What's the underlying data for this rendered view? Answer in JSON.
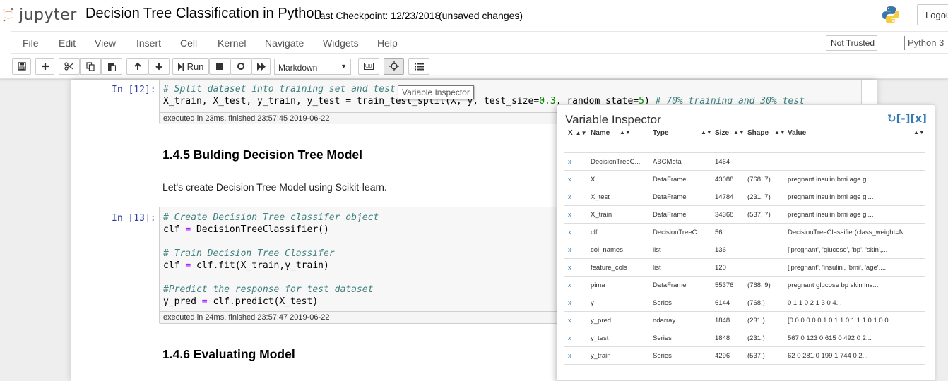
{
  "app": {
    "logo_text": "jupyter",
    "notebook_title": "Decision Tree Classification in Python",
    "checkpoint": "Last Checkpoint: 12/23/2018",
    "unsaved": "(unsaved changes)",
    "logout": "Logout"
  },
  "menu": {
    "items": [
      "File",
      "Edit",
      "View",
      "Insert",
      "Cell",
      "Kernel",
      "Navigate",
      "Widgets",
      "Help"
    ],
    "not_trusted": "Not Trusted",
    "kernel": "Python 3"
  },
  "toolbar": {
    "run_label": "Run",
    "cell_type": "Markdown",
    "tooltip": "Variable Inspector"
  },
  "cells": {
    "c12": {
      "prompt": "In [12]:",
      "line1": "# Split dataset into training set and test set",
      "line2_a": "X_train, X_test, y_train, y_test = train_test_split(X, y, test_size=",
      "line2_num1": "0.3",
      "line2_b": ", random_state=",
      "line2_num2": "5",
      "line2_c": ") ",
      "line2_comment": "# 70% training and 30% test",
      "exec": "executed in 23ms, finished 23:57:45 2019-06-22"
    },
    "h145": "1.4.5  Bulding Decision Tree Model",
    "md_text": "Let's create Decision Tree Model using Scikit-learn.",
    "c13": {
      "prompt": "In [13]:",
      "l1": "# Create Decision Tree classifer object",
      "l2a": "clf ",
      "l2op": "=",
      "l2b": " DecisionTreeClassifier()",
      "l4": "# Train Decision Tree Classifer",
      "l5a": "clf ",
      "l5op": "=",
      "l5b": " clf.fit(X_train,y_train)",
      "l7": "#Predict the response for test dataset",
      "l8a": "y_pred ",
      "l8op": "=",
      "l8b": " clf.predict(X_test)",
      "exec": "executed in 24ms, finished 23:57:47 2019-06-22"
    },
    "h146": "1.4.6  Evaluating Model"
  },
  "inspector": {
    "title": "Variable Inspector",
    "controls": "↻[-][x]",
    "headers": [
      "X",
      "Name",
      "Type",
      "Size",
      "Shape",
      "Value"
    ],
    "rows": [
      {
        "del": "x",
        "name": "DecisionTreeC...",
        "type": "ABCMeta",
        "size": "1464",
        "shape": "",
        "value": ""
      },
      {
        "del": "x",
        "name": "X",
        "type": "DataFrame",
        "size": "43088",
        "shape": "(768, 7)",
        "value": "pregnant insulin bmi age gl..."
      },
      {
        "del": "x",
        "name": "X_test",
        "type": "DataFrame",
        "size": "14784",
        "shape": "(231, 7)",
        "value": "pregnant insulin bmi age gl..."
      },
      {
        "del": "x",
        "name": "X_train",
        "type": "DataFrame",
        "size": "34368",
        "shape": "(537, 7)",
        "value": "pregnant insulin bmi age gl..."
      },
      {
        "del": "x",
        "name": "clf",
        "type": "DecisionTreeC...",
        "size": "56",
        "shape": "",
        "value": "DecisionTreeClassifier(class_weight=N..."
      },
      {
        "del": "x",
        "name": "col_names",
        "type": "list",
        "size": "136",
        "shape": "",
        "value": "['pregnant', 'glucose', 'bp', 'skin',..."
      },
      {
        "del": "x",
        "name": "feature_cols",
        "type": "list",
        "size": "120",
        "shape": "",
        "value": "['pregnant', 'insulin', 'bmi', 'age',..."
      },
      {
        "del": "x",
        "name": "pima",
        "type": "DataFrame",
        "size": "55376",
        "shape": "(768, 9)",
        "value": "pregnant glucose bp skin ins..."
      },
      {
        "del": "x",
        "name": "y",
        "type": "Series",
        "size": "6144",
        "shape": "(768,)",
        "value": "0 1 1 0 2 1 3 0 4..."
      },
      {
        "del": "x",
        "name": "y_pred",
        "type": "ndarray",
        "size": "1848",
        "shape": "(231,)",
        "value": "[0 0 0 0 0 0 1 0 1 1 0 1 1 1 0 1 0 0 ..."
      },
      {
        "del": "x",
        "name": "y_test",
        "type": "Series",
        "size": "1848",
        "shape": "(231,)",
        "value": "567 0 123 0 615 0 492 0 2..."
      },
      {
        "del": "x",
        "name": "y_train",
        "type": "Series",
        "size": "4296",
        "shape": "(537,)",
        "value": "62 0 281 0 199 1 744 0 2..."
      }
    ]
  }
}
